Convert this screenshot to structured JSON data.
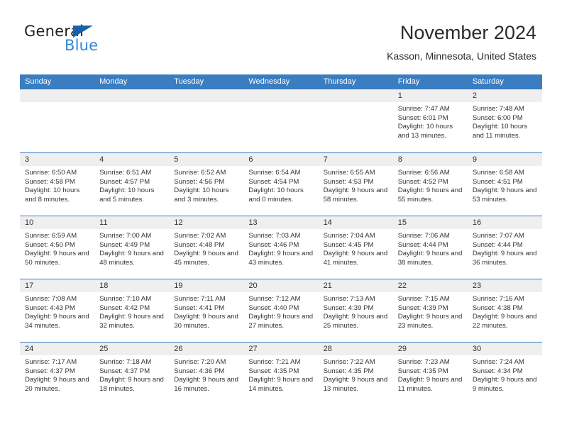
{
  "brand": {
    "name_top": "General",
    "name_bottom": "Blue",
    "triangle_color": "#1464ad",
    "blue_color": "#2e87d6"
  },
  "header": {
    "title": "November 2024",
    "subtitle": "Kasson, Minnesota, United States"
  },
  "theme": {
    "header_blue": "#3a7dc0",
    "day_number_band": "#efefef",
    "text": "#333333"
  },
  "calendar": {
    "weekday_headers": [
      "Sunday",
      "Monday",
      "Tuesday",
      "Wednesday",
      "Thursday",
      "Friday",
      "Saturday"
    ],
    "weeks": [
      [
        {
          "day": "",
          "sunrise": "",
          "sunset": "",
          "daylight": ""
        },
        {
          "day": "",
          "sunrise": "",
          "sunset": "",
          "daylight": ""
        },
        {
          "day": "",
          "sunrise": "",
          "sunset": "",
          "daylight": ""
        },
        {
          "day": "",
          "sunrise": "",
          "sunset": "",
          "daylight": ""
        },
        {
          "day": "",
          "sunrise": "",
          "sunset": "",
          "daylight": ""
        },
        {
          "day": "1",
          "sunrise": "Sunrise: 7:47 AM",
          "sunset": "Sunset: 6:01 PM",
          "daylight": "Daylight: 10 hours and 13 minutes."
        },
        {
          "day": "2",
          "sunrise": "Sunrise: 7:48 AM",
          "sunset": "Sunset: 6:00 PM",
          "daylight": "Daylight: 10 hours and 11 minutes."
        }
      ],
      [
        {
          "day": "3",
          "sunrise": "Sunrise: 6:50 AM",
          "sunset": "Sunset: 4:58 PM",
          "daylight": "Daylight: 10 hours and 8 minutes."
        },
        {
          "day": "4",
          "sunrise": "Sunrise: 6:51 AM",
          "sunset": "Sunset: 4:57 PM",
          "daylight": "Daylight: 10 hours and 5 minutes."
        },
        {
          "day": "5",
          "sunrise": "Sunrise: 6:52 AM",
          "sunset": "Sunset: 4:56 PM",
          "daylight": "Daylight: 10 hours and 3 minutes."
        },
        {
          "day": "6",
          "sunrise": "Sunrise: 6:54 AM",
          "sunset": "Sunset: 4:54 PM",
          "daylight": "Daylight: 10 hours and 0 minutes."
        },
        {
          "day": "7",
          "sunrise": "Sunrise: 6:55 AM",
          "sunset": "Sunset: 4:53 PM",
          "daylight": "Daylight: 9 hours and 58 minutes."
        },
        {
          "day": "8",
          "sunrise": "Sunrise: 6:56 AM",
          "sunset": "Sunset: 4:52 PM",
          "daylight": "Daylight: 9 hours and 55 minutes."
        },
        {
          "day": "9",
          "sunrise": "Sunrise: 6:58 AM",
          "sunset": "Sunset: 4:51 PM",
          "daylight": "Daylight: 9 hours and 53 minutes."
        }
      ],
      [
        {
          "day": "10",
          "sunrise": "Sunrise: 6:59 AM",
          "sunset": "Sunset: 4:50 PM",
          "daylight": "Daylight: 9 hours and 50 minutes."
        },
        {
          "day": "11",
          "sunrise": "Sunrise: 7:00 AM",
          "sunset": "Sunset: 4:49 PM",
          "daylight": "Daylight: 9 hours and 48 minutes."
        },
        {
          "day": "12",
          "sunrise": "Sunrise: 7:02 AM",
          "sunset": "Sunset: 4:48 PM",
          "daylight": "Daylight: 9 hours and 45 minutes."
        },
        {
          "day": "13",
          "sunrise": "Sunrise: 7:03 AM",
          "sunset": "Sunset: 4:46 PM",
          "daylight": "Daylight: 9 hours and 43 minutes."
        },
        {
          "day": "14",
          "sunrise": "Sunrise: 7:04 AM",
          "sunset": "Sunset: 4:45 PM",
          "daylight": "Daylight: 9 hours and 41 minutes."
        },
        {
          "day": "15",
          "sunrise": "Sunrise: 7:06 AM",
          "sunset": "Sunset: 4:44 PM",
          "daylight": "Daylight: 9 hours and 38 minutes."
        },
        {
          "day": "16",
          "sunrise": "Sunrise: 7:07 AM",
          "sunset": "Sunset: 4:44 PM",
          "daylight": "Daylight: 9 hours and 36 minutes."
        }
      ],
      [
        {
          "day": "17",
          "sunrise": "Sunrise: 7:08 AM",
          "sunset": "Sunset: 4:43 PM",
          "daylight": "Daylight: 9 hours and 34 minutes."
        },
        {
          "day": "18",
          "sunrise": "Sunrise: 7:10 AM",
          "sunset": "Sunset: 4:42 PM",
          "daylight": "Daylight: 9 hours and 32 minutes."
        },
        {
          "day": "19",
          "sunrise": "Sunrise: 7:11 AM",
          "sunset": "Sunset: 4:41 PM",
          "daylight": "Daylight: 9 hours and 30 minutes."
        },
        {
          "day": "20",
          "sunrise": "Sunrise: 7:12 AM",
          "sunset": "Sunset: 4:40 PM",
          "daylight": "Daylight: 9 hours and 27 minutes."
        },
        {
          "day": "21",
          "sunrise": "Sunrise: 7:13 AM",
          "sunset": "Sunset: 4:39 PM",
          "daylight": "Daylight: 9 hours and 25 minutes."
        },
        {
          "day": "22",
          "sunrise": "Sunrise: 7:15 AM",
          "sunset": "Sunset: 4:39 PM",
          "daylight": "Daylight: 9 hours and 23 minutes."
        },
        {
          "day": "23",
          "sunrise": "Sunrise: 7:16 AM",
          "sunset": "Sunset: 4:38 PM",
          "daylight": "Daylight: 9 hours and 22 minutes."
        }
      ],
      [
        {
          "day": "24",
          "sunrise": "Sunrise: 7:17 AM",
          "sunset": "Sunset: 4:37 PM",
          "daylight": "Daylight: 9 hours and 20 minutes."
        },
        {
          "day": "25",
          "sunrise": "Sunrise: 7:18 AM",
          "sunset": "Sunset: 4:37 PM",
          "daylight": "Daylight: 9 hours and 18 minutes."
        },
        {
          "day": "26",
          "sunrise": "Sunrise: 7:20 AM",
          "sunset": "Sunset: 4:36 PM",
          "daylight": "Daylight: 9 hours and 16 minutes."
        },
        {
          "day": "27",
          "sunrise": "Sunrise: 7:21 AM",
          "sunset": "Sunset: 4:35 PM",
          "daylight": "Daylight: 9 hours and 14 minutes."
        },
        {
          "day": "28",
          "sunrise": "Sunrise: 7:22 AM",
          "sunset": "Sunset: 4:35 PM",
          "daylight": "Daylight: 9 hours and 13 minutes."
        },
        {
          "day": "29",
          "sunrise": "Sunrise: 7:23 AM",
          "sunset": "Sunset: 4:35 PM",
          "daylight": "Daylight: 9 hours and 11 minutes."
        },
        {
          "day": "30",
          "sunrise": "Sunrise: 7:24 AM",
          "sunset": "Sunset: 4:34 PM",
          "daylight": "Daylight: 9 hours and 9 minutes."
        }
      ]
    ]
  }
}
